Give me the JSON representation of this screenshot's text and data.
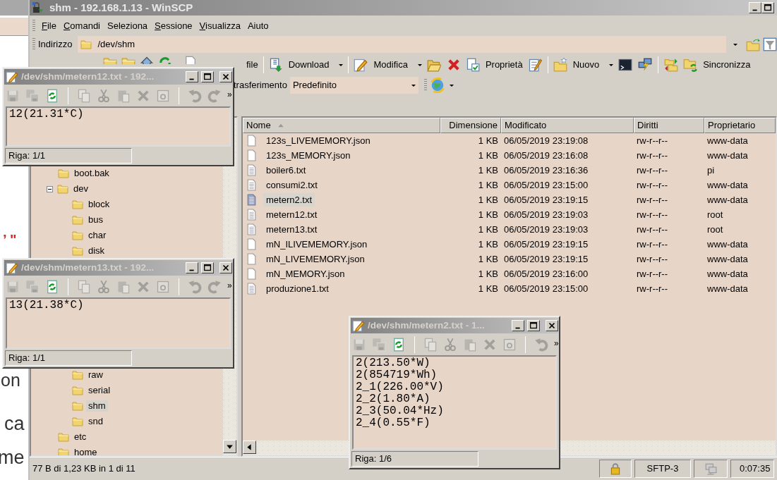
{
  "background_page": {
    "fragments": [
      {
        "kind": "quote",
        "text": "’ \""
      },
      {
        "kind": "text",
        "text": "on"
      },
      {
        "kind": "text",
        "text": "ca"
      },
      {
        "kind": "text",
        "text": "me"
      }
    ]
  },
  "window": {
    "title": "shm - 192.168.1.13 - WinSCP"
  },
  "menu": [
    {
      "label": "File",
      "accelerator": true
    },
    {
      "label": "Comandi",
      "accelerator": true
    },
    {
      "label": "Seleziona",
      "accelerator": false
    },
    {
      "label": "Sessione",
      "accelerator": true
    },
    {
      "label": "Visualizza",
      "accelerator": true
    },
    {
      "label": "Aiuto",
      "accelerator": false
    }
  ],
  "address_bar": {
    "label": "Indirizzo",
    "value": "/dev/shm"
  },
  "toolbar": {
    "transfer": "file",
    "download": "Download",
    "edit": "Modifica",
    "properties": "Proprietà",
    "new": "Nuovo",
    "synchronize": "Sincronizza"
  },
  "transfer_settings": {
    "label": "trasferimento",
    "value": "Predefinito"
  },
  "tree": [
    {
      "label": "boot.bak",
      "selected": false
    },
    {
      "label": "dev",
      "selected": false,
      "expanded": true,
      "children": [
        {
          "label": "block",
          "selected": false
        },
        {
          "label": "bus",
          "selected": false
        },
        {
          "label": "char",
          "selected": false
        },
        {
          "label": "disk",
          "selected": false
        },
        {
          "label": "raw",
          "selected": false
        },
        {
          "label": "serial",
          "selected": false
        },
        {
          "label": "shm",
          "selected": true
        },
        {
          "label": "snd",
          "selected": false
        }
      ]
    },
    {
      "label": "etc",
      "selected": false
    },
    {
      "label": "home",
      "selected": false
    }
  ],
  "file_list": {
    "columns": [
      {
        "label": "Nome",
        "sorted": true
      },
      {
        "label": "Dimensione"
      },
      {
        "label": "Modificato"
      },
      {
        "label": "Diritti"
      },
      {
        "label": "Proprietario"
      }
    ],
    "rows": [
      {
        "name": "123s_LIVEMEMORY.json",
        "size": "1 KB",
        "modified": "06/05/2019 23:19:08",
        "rights": "rw-r--r--",
        "owner": "www-data",
        "kind": "json",
        "selected": false
      },
      {
        "name": "123s_MEMORY.json",
        "size": "1 KB",
        "modified": "06/05/2019 23:16:08",
        "rights": "rw-r--r--",
        "owner": "www-data",
        "kind": "json",
        "selected": false
      },
      {
        "name": "boiler6.txt",
        "size": "1 KB",
        "modified": "06/05/2019 23:16:36",
        "rights": "rw-r--r--",
        "owner": "pi",
        "kind": "text",
        "selected": false
      },
      {
        "name": "consumi2.txt",
        "size": "1 KB",
        "modified": "06/05/2019 23:15:00",
        "rights": "rw-r--r--",
        "owner": "www-data",
        "kind": "text",
        "selected": false
      },
      {
        "name": "metern2.txt",
        "size": "1 KB",
        "modified": "06/05/2019 23:19:15",
        "rights": "rw-r--r--",
        "owner": "www-data",
        "kind": "text",
        "selected": true
      },
      {
        "name": "metern12.txt",
        "size": "1 KB",
        "modified": "06/05/2019 23:19:03",
        "rights": "rw-r--r--",
        "owner": "root",
        "kind": "text",
        "selected": false
      },
      {
        "name": "metern13.txt",
        "size": "1 KB",
        "modified": "06/05/2019 23:19:03",
        "rights": "rw-r--r--",
        "owner": "root",
        "kind": "text",
        "selected": false
      },
      {
        "name": "mN_ILIVEMEMORY.json",
        "size": "1 KB",
        "modified": "06/05/2019 23:19:15",
        "rights": "rw-r--r--",
        "owner": "www-data",
        "kind": "json",
        "selected": false
      },
      {
        "name": "mN_LIVEMEMORY.json",
        "size": "1 KB",
        "modified": "06/05/2019 23:19:15",
        "rights": "rw-r--r--",
        "owner": "www-data",
        "kind": "json",
        "selected": false
      },
      {
        "name": "mN_MEMORY.json",
        "size": "1 KB",
        "modified": "06/05/2019 23:16:00",
        "rights": "rw-r--r--",
        "owner": "www-data",
        "kind": "json",
        "selected": false
      },
      {
        "name": "produzione1.txt",
        "size": "1 KB",
        "modified": "06/05/2019 23:15:00",
        "rights": "rw-r--r--",
        "owner": "www-data",
        "kind": "text",
        "selected": false
      }
    ]
  },
  "status_bar": {
    "selection": "77 B di 1,23 KB in 1 di 11",
    "protocol": "SFTP-3",
    "elapsed": "0:07:35"
  },
  "editors": [
    {
      "title": "/dev/shm/metern12.txt - 192...",
      "tools": [
        {
          "kind": "save",
          "disabled": true
        },
        {
          "kind": "save_all",
          "disabled": true
        },
        {
          "kind": "reload",
          "disabled": false
        },
        {
          "kind": "copy",
          "disabled": true
        },
        {
          "kind": "cut",
          "disabled": true
        },
        {
          "kind": "paste",
          "disabled": true
        },
        {
          "kind": "delete",
          "disabled": true
        },
        {
          "kind": "find",
          "disabled": true
        },
        {
          "kind": "undo",
          "disabled": true
        },
        {
          "kind": "redo",
          "disabled": true
        }
      ],
      "more": "»",
      "lines": [
        "12(21.31*C)"
      ],
      "status": "Riga: 1/1"
    },
    {
      "title": "/dev/shm/metern13.txt - 192...",
      "tools": [
        {
          "kind": "save",
          "disabled": true
        },
        {
          "kind": "save_all",
          "disabled": true
        },
        {
          "kind": "reload",
          "disabled": false
        },
        {
          "kind": "copy",
          "disabled": true
        },
        {
          "kind": "cut",
          "disabled": true
        },
        {
          "kind": "paste",
          "disabled": true
        },
        {
          "kind": "delete",
          "disabled": true
        },
        {
          "kind": "find",
          "disabled": true
        },
        {
          "kind": "undo",
          "disabled": true
        },
        {
          "kind": "redo",
          "disabled": true
        }
      ],
      "more": "»",
      "lines": [
        "13(21.38*C)"
      ],
      "status": "Riga: 1/1"
    },
    {
      "title": "/dev/shm/metern2.txt - 1...",
      "tools": [
        {
          "kind": "save",
          "disabled": true
        },
        {
          "kind": "save_all",
          "disabled": true
        },
        {
          "kind": "reload",
          "disabled": false
        },
        {
          "kind": "copy",
          "disabled": true
        },
        {
          "kind": "cut",
          "disabled": true
        },
        {
          "kind": "paste",
          "disabled": true
        },
        {
          "kind": "delete",
          "disabled": true
        },
        {
          "kind": "find",
          "disabled": true
        },
        {
          "kind": "undo",
          "disabled": true
        }
      ],
      "more": "»",
      "lines": [
        "2(213.50*W)",
        "2(854719*Wh)",
        "2_1(226.00*V)",
        "2_2(1.80*A)",
        "2_3(50.04*Hz)",
        "2_4(0.55*F)"
      ],
      "status": "Riga: 1/6"
    }
  ]
}
